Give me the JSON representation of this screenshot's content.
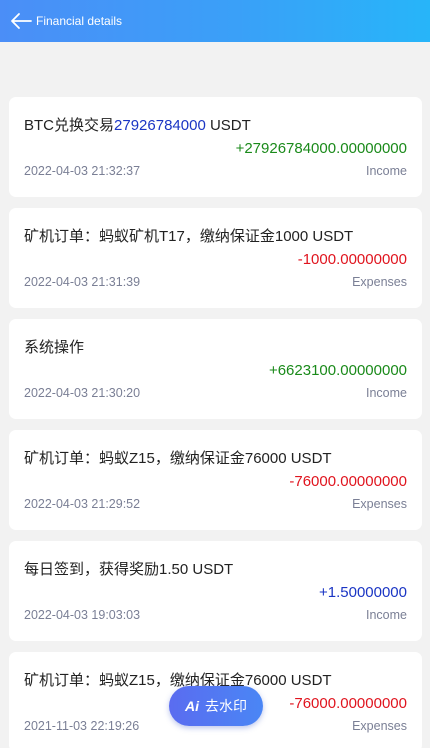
{
  "header": {
    "title": "Financial details",
    "back_icon": "arrow-left-icon"
  },
  "records": [
    {
      "title": "BTC兑换交易",
      "title_highlight": "27926784000",
      "title_suffix": " USDT",
      "amount": "+27926784000.00000000",
      "date": "2022-04-03 21:32:37",
      "type": "Income",
      "color": "#1a8a1a"
    },
    {
      "title": "矿机订单：蚂蚁矿机T17，缴纳保证金1000 USDT",
      "title_highlight": "",
      "title_suffix": "",
      "amount": "-1000.00000000",
      "date": "2022-04-03 21:31:39",
      "type": "Expenses",
      "color": "#e0141e"
    },
    {
      "title": "系统操作",
      "title_highlight": "",
      "title_suffix": "",
      "amount": "+6623100.00000000",
      "date": "2022-04-03 21:30:20",
      "type": "Income",
      "color": "#1a8a1a"
    },
    {
      "title": "矿机订单：蚂蚁Z15，缴纳保证金76000 USDT",
      "title_highlight": "",
      "title_suffix": "",
      "amount": "-76000.00000000",
      "date": "2022-04-03 21:29:52",
      "type": "Expenses",
      "color": "#e0141e"
    },
    {
      "title": "每日签到，获得奖励1.50 USDT",
      "title_highlight": "",
      "title_suffix": "",
      "amount": "+1.50000000",
      "date": "2022-04-03 19:03:03",
      "type": "Income",
      "color": "#1a35c4"
    },
    {
      "title": "矿机订单：蚂蚁Z15，缴纳保证金76000 USDT",
      "title_highlight": "",
      "title_suffix": "",
      "amount": "-76000.00000000",
      "date": "2021-11-03 22:19:26",
      "type": "Expenses",
      "color": "#e0141e"
    }
  ],
  "watermark_button": {
    "ai_label": "Ai",
    "label": "去水印"
  },
  "colors": {
    "header_start": "#4b8ef7",
    "header_end": "#27b5f9",
    "income": "#1a8a1a",
    "expense": "#e0141e",
    "highlight": "#1a35c4"
  }
}
